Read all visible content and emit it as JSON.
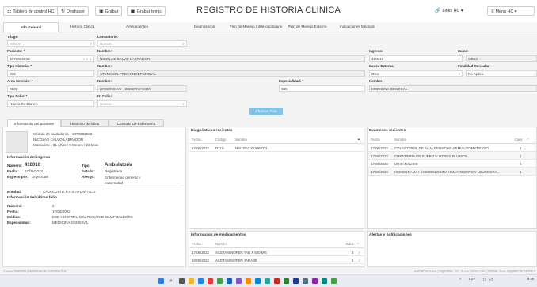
{
  "toolbar": {
    "dashboard": "Tablero de control HC",
    "undo": "Deshacer",
    "save": "Grabar",
    "save_temp": "Grabar temp.",
    "title": "REGISTRO DE HISTORIA CLINICA",
    "links": "Links HC",
    "menu": "Menu HC"
  },
  "tabs": [
    "Info General",
    "Historia Clinica",
    "Antecedentes",
    "Diagnósticos",
    "Plan de Manejo IntraHospitalario",
    "Plan de Manejo Externo",
    "Indicaciones Médicas"
  ],
  "form": {
    "triage_label": "Triage:",
    "triage_placeholder": "Buscar...",
    "consultorio_label": "Consultorio:",
    "consultorio_placeholder": "Buscar...",
    "paciente_label": "Paciente: *",
    "paciente_value": "1070602502",
    "nombre_label": "Nombre:",
    "paciente_nombre": "NICOLAS CALVO LABRADOR",
    "ingreso_label": "Ingreso:",
    "ingreso_value": "410016",
    "cama_label": "Cama:",
    "cama_value": "OB53",
    "tipo_historia_label": "Tipo Historia: *",
    "tipo_historia_value": "002",
    "tipo_historia_nombre": "ATENCION PRECONCEPCIONAL",
    "causa_externa_label": "Causa Externa:",
    "causa_externa_value": "Otra",
    "finalidad_label": "Finalidad Consulta:",
    "finalidad_value": "No Aplica",
    "area_label": "Area Servicio: *",
    "area_value": "0102",
    "area_nombre": "URGENCIAS - OBSERVACION",
    "especialidad_label": "Especialidad: *",
    "especialidad_value": "385",
    "especialidad_nombre": "MEDICINA GENERAL",
    "tipo_folio_label": "Tipo Folio: *",
    "tipo_folio_value": "Nuevo En Blanco",
    "n_folio_label": "N° Folio:",
    "n_folio_placeholder": "Buscar...",
    "search_button": "Buscar Folio"
  },
  "subtabs": [
    "Información del paciente",
    "Histórico de folios",
    "Consulta de Enfermería"
  ],
  "patient": {
    "cedula": "Cédula de ciudadanía - 1070602502",
    "name": "NICOLAS CALVO LABRADOR",
    "age": "Masculino • 31 Años / 6 Meses / 23 Días",
    "ingreso_title": "Información del ingreso",
    "numero_label": "Número:",
    "numero": "410016",
    "tipo_label": "Tipo:",
    "tipo": "Ambulatorio",
    "fecha_label": "Fecha:",
    "fecha": "17/06/2022",
    "estado_label": "Estado:",
    "estado": "Registrado",
    "ingreso_por_label": "Ingreso por:",
    "ingreso_por": "Urgencias",
    "riesgo_label": "Riesgo:",
    "riesgo": "Enfermedad general y maternidad",
    "entidad_label": "Entidad:",
    "entidad": "CAJACOPI E.P.S-S ATLANTICO",
    "folio_title": "Información del último folio",
    "f_numero_label": "Número:",
    "f_numero": "5",
    "f_fecha_label": "Fecha:",
    "f_fecha": "17/06/2022",
    "medico_label": "Médico:",
    "medico": "ESE HOSPITAL DEL ROSARIO CAMPOALEGRE",
    "esp_label": "Especialidad:",
    "esp": "MEDICINA GENERAL"
  },
  "diagnosticos": {
    "title": "Diagnósticos recientes",
    "headers": [
      "Fecha",
      "Código",
      "Nombre"
    ],
    "rows": [
      [
        "17/06/2022",
        "R11X",
        "NAUSEA Y VOMITO"
      ]
    ]
  },
  "examenes": {
    "title": "Exámenes recientes",
    "headers": [
      "Fecha",
      "Nombre",
      "Cant."
    ],
    "rows": [
      [
        "17/06/2022",
        "COLESTEROL DE BAJA DENSIDAD SEMIAUTOMATIZADO",
        "1"
      ],
      [
        "17/06/2022",
        "CREATININA EN SUERO U OTROS FLUIDOS",
        "1"
      ],
      [
        "17/06/2022",
        "UROANALISIS",
        "1"
      ],
      [
        "17/06/2022",
        "HEMOGRAMA I (HEMOGLOBINA HEMATOCRITO Y LEUCOGRA...",
        "1"
      ]
    ]
  },
  "medicamentos": {
    "title": "Informacion de medicamentos",
    "headers": [
      "Fecha",
      "Nombre",
      "Cant."
    ],
    "rows": [
      [
        "17/06/2022",
        "ACETAMINOFEN TAB X 500 MG",
        "3"
      ],
      [
        "10/06/2022",
        "ACETAMINOFEN JARABE",
        "1"
      ]
    ]
  },
  "alertas": {
    "title": "Alertas y notificaciones"
  },
  "status": {
    "left": "© 2022 Sistemas y Asesorias de Colombia S.A.",
    "right": "DGEMPRESS03 | Urgencias - 01 - E.S.E. HOSPITAL | Versión: 2022 Upgrade 06 Parche 2"
  },
  "taskbar": {
    "lang": "ESP",
    "time": "9:56"
  },
  "colors": {
    "accent": "#7ec3ea",
    "check": "#2e8bc9"
  }
}
